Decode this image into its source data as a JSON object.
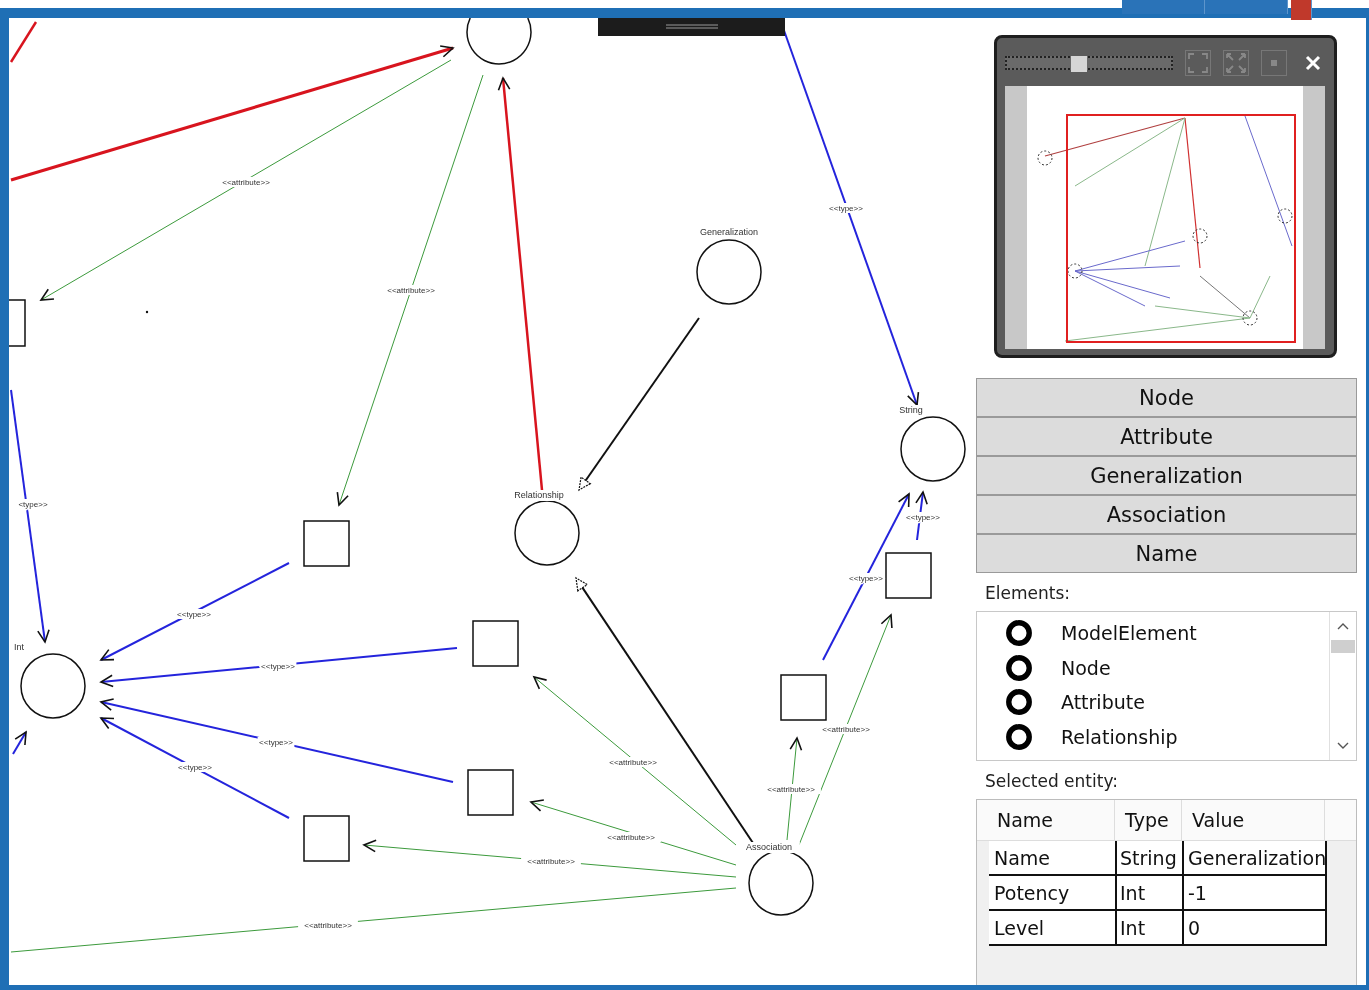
{
  "diagram": {
    "nodes": [
      {
        "kind": "circle"
      },
      {
        "kind": "square"
      },
      {
        "kind": "circle",
        "label": "Generalization"
      },
      {
        "kind": "circle",
        "label": "String"
      },
      {
        "kind": "circle",
        "label": "Relationship"
      },
      {
        "kind": "circle",
        "label": "Int"
      },
      {
        "kind": "circle",
        "label": "Association"
      },
      {
        "kind": "square"
      },
      {
        "kind": "square"
      },
      {
        "kind": "square"
      },
      {
        "kind": "square"
      },
      {
        "kind": "square"
      },
      {
        "kind": "square"
      }
    ],
    "edges": [
      {
        "color": "#d8141e",
        "kind": "arrow"
      },
      {
        "color": "#d8141e",
        "kind": "line"
      },
      {
        "color": "#3c9a3c",
        "kind": "arrow",
        "label": "<<attribute>>"
      },
      {
        "color": "#3c9a3c",
        "kind": "arrow",
        "label": "<<attribute>>"
      },
      {
        "color": "#d8141e",
        "kind": "arrow"
      },
      {
        "color": "#111111",
        "kind": "generalization"
      },
      {
        "color": "#2424dc",
        "kind": "arrow",
        "label": "<<type>>"
      },
      {
        "color": "#2424dc",
        "kind": "arrow",
        "label": "<type>>"
      },
      {
        "color": "#2424dc",
        "kind": "arrow",
        "label": "<<type>>"
      },
      {
        "color": "#2424dc",
        "kind": "arrow",
        "label": "<<type>>"
      },
      {
        "color": "#2424dc",
        "kind": "arrow",
        "label": "<<type>>"
      },
      {
        "color": "#2424dc",
        "kind": "arrow",
        "label": "<<type>>"
      },
      {
        "color": "#2424dc",
        "kind": "arrow"
      },
      {
        "color": "#111111",
        "kind": "generalization"
      },
      {
        "color": "#3c9a3c",
        "kind": "arrow",
        "label": "<<attribute>>"
      },
      {
        "color": "#3c9a3c",
        "kind": "arrow",
        "label": "<<attribute>>"
      },
      {
        "color": "#3c9a3c",
        "kind": "arrow",
        "label": "<<attribute>>"
      },
      {
        "color": "#3c9a3c",
        "kind": "line",
        "label": "<<attribute>>"
      },
      {
        "color": "#3c9a3c",
        "kind": "arrow",
        "label": "<<attribute>>"
      },
      {
        "color": "#2424dc",
        "kind": "arrow",
        "label": "<<type>>"
      },
      {
        "color": "#3c9a3c",
        "kind": "arrow",
        "label": "<<attribute>>"
      },
      {
        "color": "#2424dc",
        "kind": "arrow",
        "label": "<<type>>"
      }
    ]
  },
  "minimap": {
    "zoom_slider": {
      "level": 0.44
    }
  },
  "palette": [
    "Node",
    "Attribute",
    "Generalization",
    "Association",
    "Name"
  ],
  "elements": {
    "label": "Elements:",
    "items": [
      "ModelElement",
      "Node",
      "Attribute",
      "Relationship"
    ]
  },
  "selected_entity": {
    "label": "Selected entity:",
    "columns": [
      "Name",
      "Type",
      "Value"
    ],
    "rows": [
      [
        "Name",
        "String",
        "Generalization"
      ],
      [
        "Potency",
        "Int",
        "-1"
      ],
      [
        "Level",
        "Int",
        "0"
      ]
    ]
  }
}
